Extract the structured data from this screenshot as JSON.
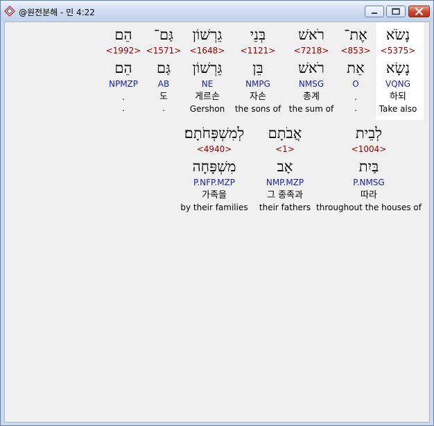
{
  "window": {
    "title": "@원전분해 - 민 4:22"
  },
  "row1": [
    {
      "hebrew": "נָשֹׂא",
      "strong": "<5375>",
      "lemma": "נָשָׂא",
      "morph": "VQNG",
      "korean": "하되",
      "gloss": "Take also"
    },
    {
      "hebrew": "אֶת־",
      "strong": "<853>",
      "lemma": "אֵת",
      "morph": "O",
      "korean": ".",
      "gloss": "."
    },
    {
      "hebrew": "רֹאשׁ",
      "strong": "<7218>",
      "lemma": "רֹאשׁ",
      "morph": "NMSG",
      "korean": "총계",
      "gloss": "the sum of"
    },
    {
      "hebrew": "בְּנֵי",
      "strong": "<1121>",
      "lemma": "בֵּן",
      "morph": "NMPG",
      "korean": "자손",
      "gloss": "the sons of"
    },
    {
      "hebrew": "גֵרְשׁוֹן",
      "strong": "<1648>",
      "lemma": "גֵּרְשׁוֹן",
      "morph": "NE",
      "korean": "게르손",
      "gloss": "Gershon"
    },
    {
      "hebrew": "גַּם־",
      "strong": "<1571>",
      "lemma": "גַּם",
      "morph": "AB",
      "korean": "도",
      "gloss": "."
    },
    {
      "hebrew": "הֵם",
      "strong": "<1992>",
      "lemma": "הֵם",
      "morph": "NPMZP",
      "korean": ".",
      "gloss": "."
    }
  ],
  "row2": [
    {
      "hebrew": "לְבֵית",
      "strong": "<1004>",
      "lemma": "בַּיִת",
      "morph": "P.NMSG",
      "korean": "따라",
      "gloss": "throughout the houses of"
    },
    {
      "hebrew": "אֲבֹתָם",
      "strong": "<1>",
      "lemma": "אָב",
      "morph": "NMP.MZP",
      "korean": "그 종족과",
      "gloss": "their fathers"
    },
    {
      "hebrew": "לְמִשְׁפְּחֹתָם׃",
      "strong": "<4940>",
      "lemma": "מִשְׁפָּחָה",
      "morph": "P.NFP.MZP",
      "korean": "가족을",
      "gloss": "by their families"
    }
  ]
}
